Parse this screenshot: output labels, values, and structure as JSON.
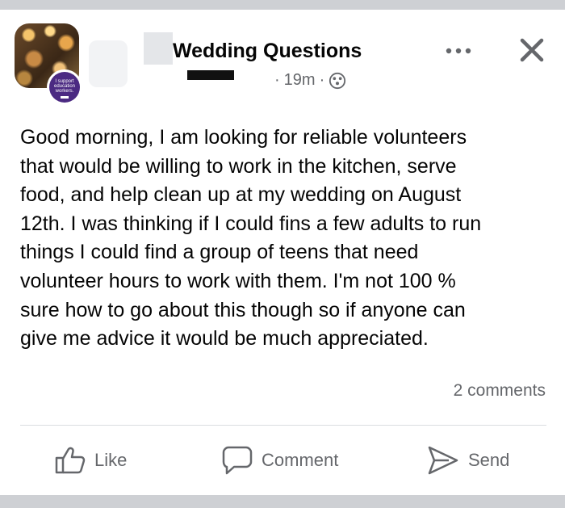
{
  "post": {
    "group_name": "Wedding Questions",
    "time": "19m",
    "separator": "·",
    "badge_text": "I support education workers.",
    "body_lines": [
      "Good morning, I am looking for reliable volunteers",
      "that would be willing to work in the kitchen, serve",
      "food, and help clean up at my wedding on August",
      "12th. I was thinking if I could fins a few adults to run",
      "things I could find a group of teens that need",
      "volunteer hours to work with them. I'm not 100 %",
      "sure how to go about this though so if anyone can",
      "give me advice it would be much appreciated."
    ],
    "comments_count": "2 comments"
  },
  "actions": {
    "like_label": "Like",
    "comment_label": "Comment",
    "send_label": "Send"
  },
  "icons": {
    "more": "more-options-icon",
    "close": "close-icon",
    "privacy": "group-audience-icon",
    "like": "thumbs-up-icon",
    "comment": "comment-bubble-icon",
    "send": "send-arrow-icon"
  },
  "colors": {
    "text_primary": "#050505",
    "text_secondary": "#65676b",
    "band": "#ced0d4",
    "badge": "#4b2a82"
  }
}
